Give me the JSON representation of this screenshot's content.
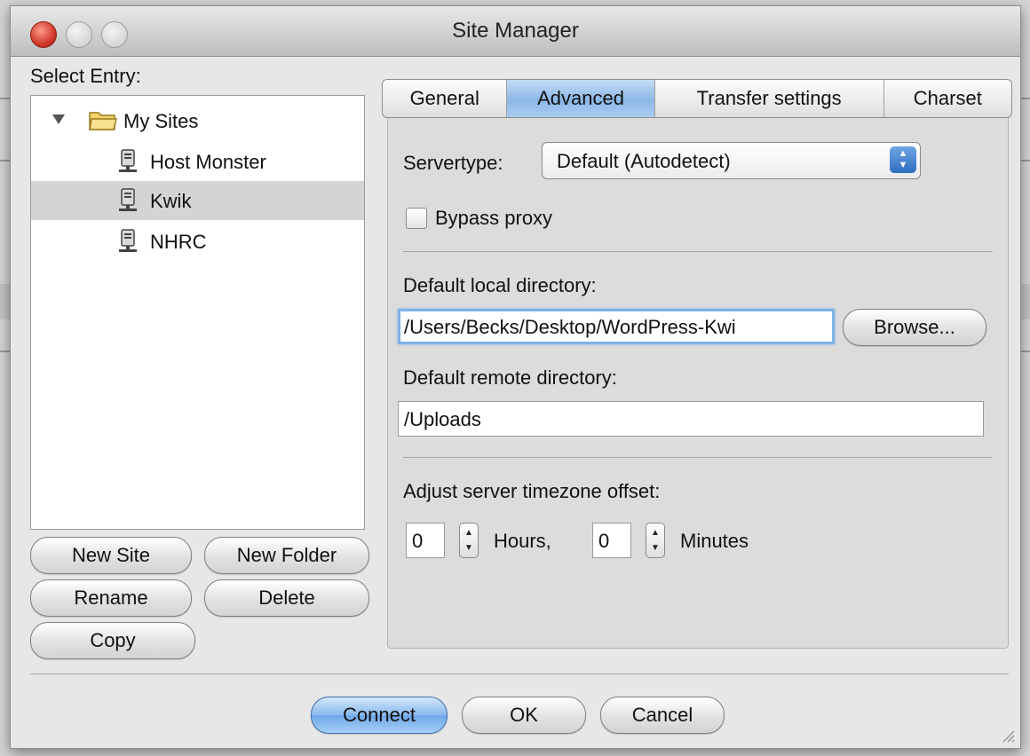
{
  "window": {
    "title": "Site Manager"
  },
  "left": {
    "select_entry_label": "Select Entry:",
    "tree": {
      "folder": "My Sites",
      "sites": [
        "Host Monster",
        "Kwik",
        "NHRC"
      ],
      "selected": "Kwik"
    },
    "buttons": {
      "new_site": "New Site",
      "new_folder": "New Folder",
      "rename": "Rename",
      "delete": "Delete",
      "copy": "Copy"
    }
  },
  "tabs": [
    "General",
    "Advanced",
    "Transfer settings",
    "Charset"
  ],
  "active_tab": "Advanced",
  "advanced": {
    "servertype_label": "Servertype:",
    "servertype_value": "Default (Autodetect)",
    "bypass_proxy_label": "Bypass proxy",
    "bypass_proxy_checked": false,
    "local_dir_label": "Default local directory:",
    "local_dir_value": "/Users/Becks/Desktop/WordPress-Kwi",
    "browse_label": "Browse...",
    "remote_dir_label": "Default remote directory:",
    "remote_dir_value": "/Uploads",
    "timezone_label": "Adjust server timezone offset:",
    "hours_value": "0",
    "hours_label": "Hours,",
    "minutes_value": "0",
    "minutes_label": "Minutes"
  },
  "footer": {
    "connect": "Connect",
    "ok": "OK",
    "cancel": "Cancel"
  }
}
